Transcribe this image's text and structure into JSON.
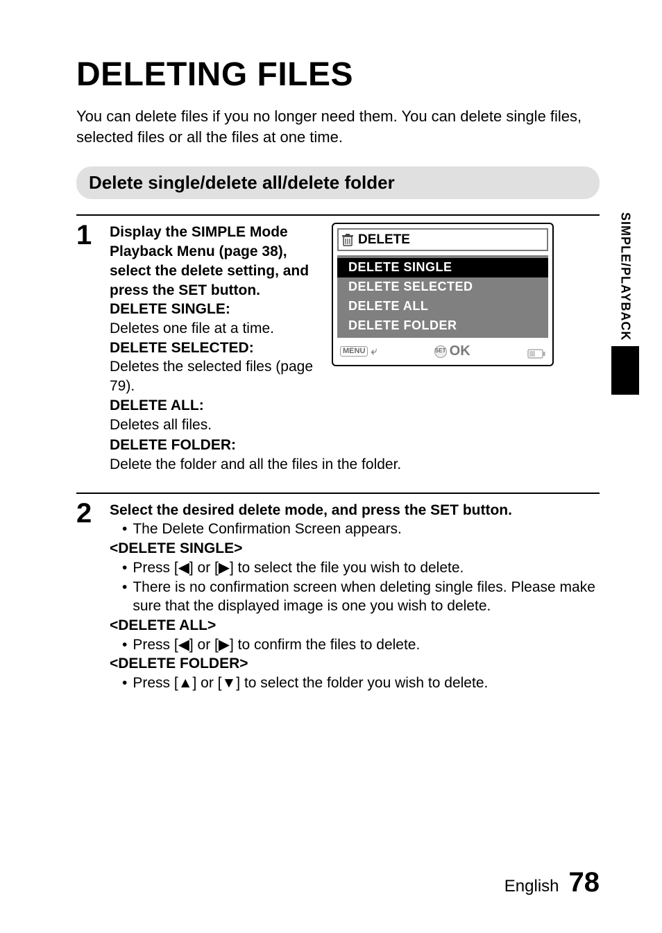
{
  "title": "DELETING FILES",
  "intro": "You can delete files if you no longer need them. You can delete single files, selected files or all the files at one time.",
  "section_heading": "Delete single/delete all/delete folder",
  "side_tab": "SIMPLE/PLAYBACK",
  "footer": {
    "lang": "English",
    "page": "78"
  },
  "step1": {
    "num": "1",
    "lead": "Display the SIMPLE Mode Playback Menu (page 38), select the delete setting, and press the SET button.",
    "items": [
      {
        "label": "DELETE SINGLE:",
        "desc": "Deletes one file at a time."
      },
      {
        "label": "DELETE SELECTED:",
        "desc": "Deletes the selected files (page 79)."
      },
      {
        "label": "DELETE ALL:",
        "desc": "Deletes all files."
      },
      {
        "label": "DELETE FOLDER:",
        "desc": "Delete the folder and all the files in the folder."
      }
    ]
  },
  "menu": {
    "title": "DELETE",
    "options": [
      "DELETE SINGLE",
      "DELETE SELECTED",
      "DELETE ALL",
      "DELETE FOLDER"
    ],
    "selected_index": 0,
    "back_label": "MENU",
    "ok_label": "OK",
    "set_label": "SET"
  },
  "step2": {
    "num": "2",
    "lead": "Select the desired delete mode, and press the SET button.",
    "bullet_after_lead": "The Delete Confirmation Screen appears.",
    "groups": [
      {
        "heading": "<DELETE SINGLE>",
        "bullets": [
          "Press [◀] or [▶] to select the file you wish to delete.",
          "There is no confirmation screen when deleting single files. Please make sure that the displayed image is one you wish to delete."
        ]
      },
      {
        "heading": "<DELETE ALL>",
        "bullets": [
          "Press [◀] or [▶] to confirm the files to delete."
        ]
      },
      {
        "heading": "<DELETE FOLDER>",
        "bullets": [
          "Press [▲] or [▼] to select the folder you wish to delete."
        ]
      }
    ]
  }
}
